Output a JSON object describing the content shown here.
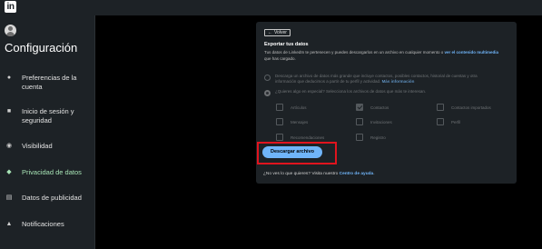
{
  "topbar": {
    "logo": "in"
  },
  "sidebar": {
    "title": "Configuración",
    "items": [
      {
        "icon": "person-icon",
        "glyph": "●",
        "label": "Preferencias de la cuenta"
      },
      {
        "icon": "lock-icon",
        "glyph": "■",
        "label": "Inicio de sesión y seguridad"
      },
      {
        "icon": "eye-icon",
        "glyph": "◉",
        "label": "Visibilidad"
      },
      {
        "icon": "shield-icon",
        "glyph": "◆",
        "label": "Privacidad de datos",
        "active": true
      },
      {
        "icon": "newspaper-icon",
        "glyph": "▤",
        "label": "Datos de publicidad"
      },
      {
        "icon": "bell-icon",
        "glyph": "▲",
        "label": "Notificaciones"
      }
    ]
  },
  "main": {
    "back_label": "Volver",
    "title": "Exportar tus datos",
    "desc_before": "Tus datos de LinkedIn te pertenecen y puedes descargarlos en un archivo en cualquier momento o ",
    "desc_link": "ver el contenido multimedia",
    "desc_after": " que has cargado.",
    "option1_before": "Descarga un archivo de datos más grande que incluye contactos, posibles contactos, historial de cuentas y otra información que deducimos a partir de tu perfil y actividad. ",
    "option1_link": "Más información",
    "option2": "¿Quieres algo en especial? Selecciona los archivos de datos que más te interesan.",
    "checkboxes": [
      {
        "label": "Artículos",
        "checked": false
      },
      {
        "label": "Contactos",
        "checked": true
      },
      {
        "label": "Contactos importados",
        "checked": false
      },
      {
        "label": "Mensajes",
        "checked": false
      },
      {
        "label": "Invitaciones",
        "checked": false
      },
      {
        "label": "Perfil",
        "checked": false
      },
      {
        "label": "Recomendaciones",
        "checked": false
      },
      {
        "label": "Registro",
        "checked": false
      }
    ],
    "download_label": "Descargar archivo",
    "help_text": "¿No ves lo que quieres? Visita nuestro ",
    "help_link": "Centro de ayuda",
    "help_end": "."
  },
  "colors": {
    "accent": "#70b5f9",
    "active": "#a7e3b5",
    "highlight": "#e0141e"
  }
}
